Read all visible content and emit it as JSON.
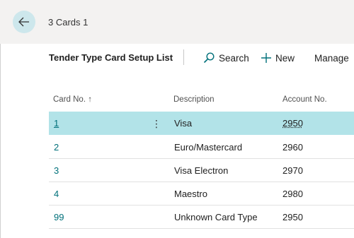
{
  "header": {
    "back_icon": "arrow-left-icon",
    "page_caption": "3 Cards 1"
  },
  "actionbar": {
    "title": "Tender Type Card Setup List",
    "search_label": "Search",
    "search_icon": "search-icon",
    "new_label": "New",
    "new_icon": "plus-icon",
    "manage_label": "Manage"
  },
  "table": {
    "columns": {
      "card_no": "Card No. ↑",
      "description": "Description",
      "account_no": "Account No."
    },
    "sort": {
      "column": "card_no",
      "direction": "ascending"
    },
    "rows": [
      {
        "card_no": "1",
        "description": "Visa",
        "account_no": "2950",
        "selected": true
      },
      {
        "card_no": "2",
        "description": "Euro/Mastercard",
        "account_no": "2960",
        "selected": false
      },
      {
        "card_no": "3",
        "description": "Visa Electron",
        "account_no": "2970",
        "selected": false
      },
      {
        "card_no": "4",
        "description": "Maestro",
        "account_no": "2980",
        "selected": false
      },
      {
        "card_no": "99",
        "description": "Unknown Card Type",
        "account_no": "2950",
        "selected": false
      }
    ],
    "row_menu_icon": "more-vertical-icon"
  },
  "colors": {
    "accent": "#00707a",
    "selected_row": "#b2e3e8",
    "back_button": "#cde7ec",
    "header_background": "#f3f2f1"
  }
}
